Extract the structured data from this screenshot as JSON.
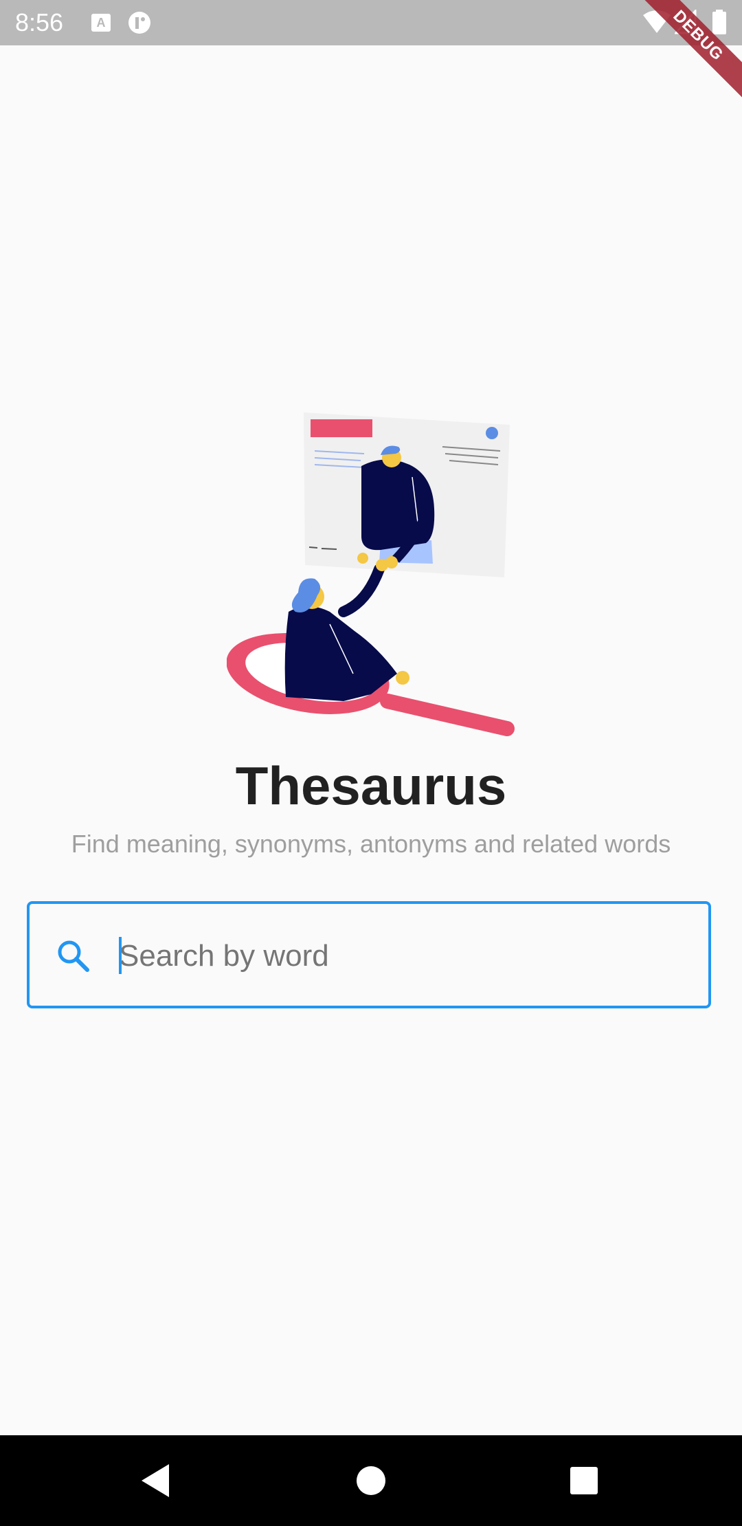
{
  "status_bar": {
    "time": "8:56",
    "icons_left": [
      "keyboard-a-icon",
      "app-notification-icon"
    ],
    "icons_right": [
      "wifi-icon",
      "cell-signal-icon",
      "battery-icon"
    ]
  },
  "debug_banner": {
    "label": "DEBUG"
  },
  "main": {
    "title": "Thesaurus",
    "subtitle": "Find meaning, synonyms, antonyms and related words",
    "illustration": "people-handshake-magnifier-illustration"
  },
  "search": {
    "placeholder": "Search by word",
    "value": "",
    "icon": "search-icon"
  },
  "nav_bar": {
    "buttons": [
      "back-icon",
      "home-icon",
      "recents-icon"
    ]
  },
  "colors": {
    "accent": "#2196f3",
    "title": "#212121",
    "subtitle": "#9e9e9e",
    "background": "#fafafa",
    "illustration_red": "#e9506e",
    "illustration_navy": "#070b4a",
    "illustration_blue": "#5b8de4"
  }
}
